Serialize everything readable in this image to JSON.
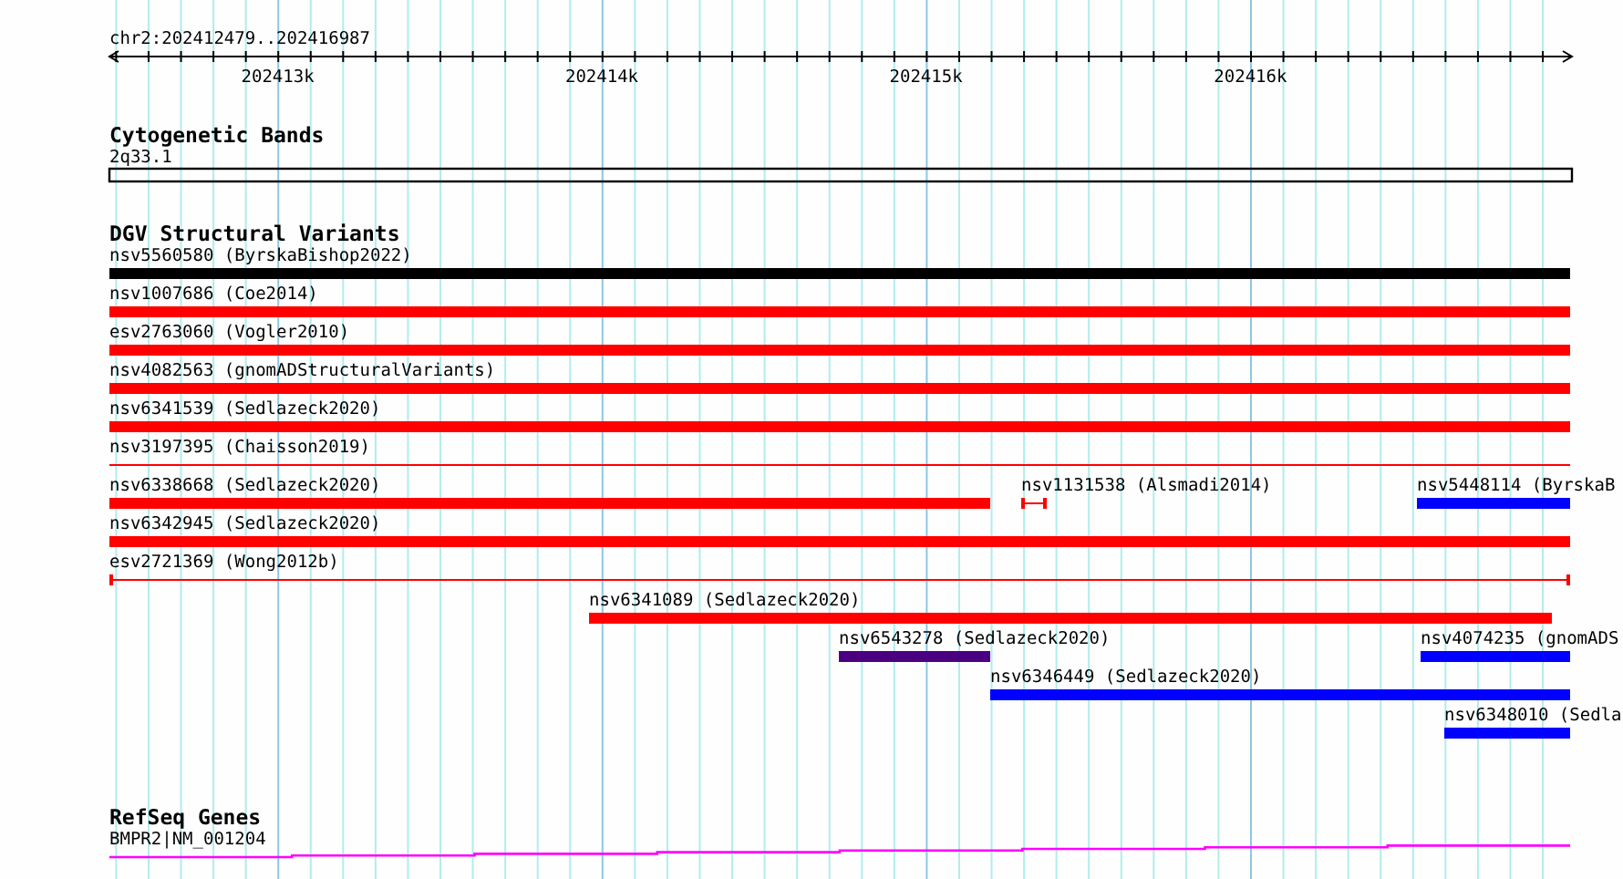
{
  "ruler": {
    "location": "chr2:202412479..202416987",
    "ticks": [
      "202413k",
      "202414k",
      "202415k",
      "202416k"
    ]
  },
  "tracks": [
    {
      "title": "Cytogenetic Bands",
      "kind": "bands",
      "features": [
        {
          "label": "2q33.1",
          "kind": "band"
        }
      ]
    },
    {
      "title": "DGV Structural Variants",
      "kind": "variants",
      "features": [
        {
          "label": "nsv5560580 (ByrskaBishop2022)",
          "kind": "bar",
          "color": "#000000"
        },
        {
          "label": "nsv1007686 (Coe2014)",
          "kind": "bar",
          "color": "#ff0000"
        },
        {
          "label": "esv2763060 (Vogler2010)",
          "kind": "bar",
          "color": "#ff0000"
        },
        {
          "label": "nsv4082563 (gnomADStructuralVariants)",
          "kind": "bar",
          "color": "#ff0000"
        },
        {
          "label": "nsv6341539 (Sedlazeck2020)",
          "kind": "bar",
          "color": "#ff0000"
        },
        {
          "label": "nsv3197395 (Chaisson2019)",
          "kind": "line",
          "color": "#ff0000"
        },
        {
          "label": "nsv6338668 (Sedlazeck2020)",
          "kind": "bar",
          "color": "#ff0000"
        },
        {
          "label": "nsv1131538 (Alsmadi2014)",
          "kind": "interval",
          "color": "#ff0000"
        },
        {
          "label": "nsv5448114 (ByrskaB",
          "kind": "bar",
          "color": "#0000ff"
        },
        {
          "label": "nsv6342945 (Sedlazeck2020)",
          "kind": "bar",
          "color": "#ff0000"
        },
        {
          "label": "esv2721369 (Wong2012b)",
          "kind": "interval",
          "color": "#ff0000"
        },
        {
          "label": "nsv6341089 (Sedlazeck2020)",
          "kind": "bar",
          "color": "#ff0000"
        },
        {
          "label": "nsv6543278 (Sedlazeck2020)",
          "kind": "bar",
          "color": "#4b0082"
        },
        {
          "label": "nsv4074235 (gnomADS",
          "kind": "bar",
          "color": "#0000ff"
        },
        {
          "label": "nsv6346449 (Sedlazeck2020)",
          "kind": "bar",
          "color": "#0000ff"
        },
        {
          "label": "nsv6348010 (Sedla",
          "kind": "bar",
          "color": "#0000ff"
        }
      ]
    },
    {
      "title": "RefSeq Genes",
      "kind": "genes",
      "features": [
        {
          "label": "BMPR2|NM_001204",
          "kind": "gene"
        }
      ]
    }
  ]
}
